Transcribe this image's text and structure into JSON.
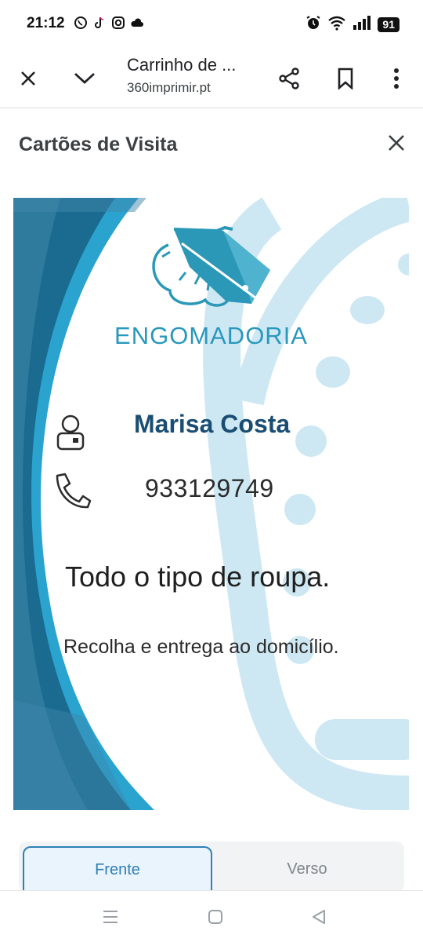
{
  "status_bar": {
    "time": "21:12",
    "battery": "91",
    "app_icons": [
      "whatsapp-icon",
      "tiktok-icon",
      "instagram-icon",
      "cloud-icon"
    ],
    "system_icons": [
      "alarm-icon",
      "wifi-icon",
      "signal-icon",
      "battery-icon"
    ]
  },
  "browser": {
    "title": "Carrinho de ...",
    "url": "360imprimir.pt",
    "icons": [
      "close-icon",
      "chevron-down-icon",
      "share-icon",
      "bookmark-icon",
      "more-vert-icon"
    ]
  },
  "modal": {
    "title": "Cartões de Visita"
  },
  "card": {
    "brand": "ENGOMADORIA",
    "name": "Marisa Costa",
    "phone": "933129749",
    "tagline": "Todo o tipo de roupa.",
    "service": "Recolha e entrega ao domicílio.",
    "colors": {
      "dark_blue": "#1b6a8f",
      "mid_blue": "#2aa3cf",
      "light_blue": "#cde8f3",
      "brand_text": "#2a98bd",
      "name_text": "#1a4d73"
    }
  },
  "tabs": [
    {
      "label": "Frente",
      "active": true
    },
    {
      "label": "Verso",
      "active": false
    }
  ],
  "nav": {
    "icons": [
      "recents-icon",
      "home-icon",
      "back-icon"
    ]
  }
}
